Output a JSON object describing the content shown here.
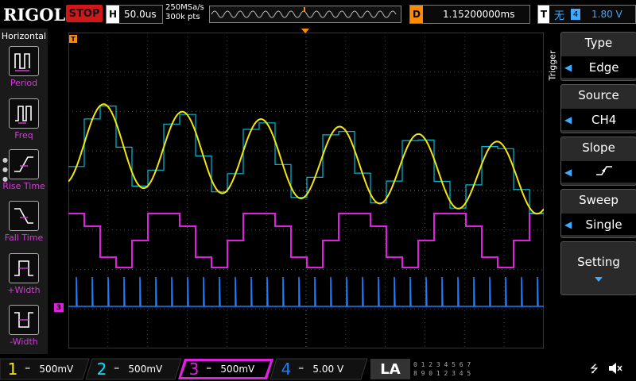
{
  "brand": "RIGOL",
  "run_state": "STOP",
  "horizontal": {
    "label": "H",
    "timebase": "50.0us",
    "sample_rate": "250MSa/s",
    "mem_depth": "300k pts"
  },
  "delay": {
    "label": "D",
    "value": "1.15200000ms"
  },
  "trigger_status": {
    "label": "T",
    "channel": "4",
    "level": "1.80 V"
  },
  "left_panel": {
    "title": "Horizontal",
    "items": [
      {
        "label": "Period",
        "icon": "period-icon"
      },
      {
        "label": "Freq",
        "icon": "freq-icon"
      },
      {
        "label": "Rise Time",
        "icon": "rise-time-icon"
      },
      {
        "label": "Fall Time",
        "icon": "fall-time-icon"
      },
      {
        "label": "+Width",
        "icon": "positive-width-icon"
      },
      {
        "label": "-Width",
        "icon": "negative-width-icon"
      }
    ]
  },
  "right_panel": {
    "menu_title": "Trigger",
    "buttons": [
      {
        "title": "Type",
        "value": "Edge"
      },
      {
        "title": "Source",
        "value": "CH4"
      },
      {
        "title": "Slope",
        "value": ""
      },
      {
        "title": "Sweep",
        "value": "Single"
      },
      {
        "title": "Setting",
        "value": ""
      }
    ]
  },
  "markers": {
    "trigger_top": "T",
    "ch3_marker": "3",
    "trigger_right": "T"
  },
  "channels": [
    {
      "num": "1",
      "scale": "500mV",
      "color": "#f5e60a"
    },
    {
      "num": "2",
      "scale": "500mV",
      "color": "#00e5ff"
    },
    {
      "num": "3",
      "scale": "500mV",
      "color": "#e020e0"
    },
    {
      "num": "4",
      "scale": "5.00 V",
      "color": "#1a7fff"
    }
  ],
  "la": {
    "label": "LA",
    "row1": "0 1 2 3  4 5 6 7",
    "row2": "8 9 0 1  2 3 4 5"
  },
  "colors": {
    "accent_orange": "#ff8a00",
    "stop_red": "#d01818",
    "trigger_blue": "#3fa8ff",
    "menu_bg": "#2a2a2a"
  }
}
